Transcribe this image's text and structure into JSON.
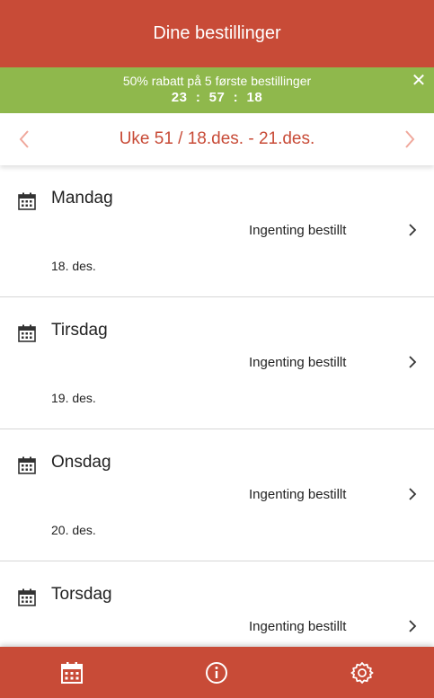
{
  "header": {
    "title": "Dine bestillinger"
  },
  "promo": {
    "text": "50% rabatt på 5 første bestillinger",
    "timer": "23  :  57  :  18",
    "close_icon": "close-icon"
  },
  "week_nav": {
    "label": "Uke 51 / 18.des. - 21.des.",
    "prev_icon": "chevron-left-icon",
    "next_icon": "chevron-right-icon"
  },
  "days": [
    {
      "name": "Mandag",
      "status": "Ingenting bestillt",
      "date": "18. des."
    },
    {
      "name": "Tirsdag",
      "status": "Ingenting bestillt",
      "date": "19. des."
    },
    {
      "name": "Onsdag",
      "status": "Ingenting bestillt",
      "date": "20. des."
    },
    {
      "name": "Torsdag",
      "status": "Ingenting bestillt",
      "date": ""
    }
  ],
  "bottom_nav": {
    "items": [
      {
        "icon": "calendar-icon"
      },
      {
        "icon": "info-icon"
      },
      {
        "icon": "settings-icon"
      }
    ]
  },
  "colors": {
    "brand": "#c84b37",
    "promo": "#8fb84c",
    "nav_arrow": "#f0a89c"
  }
}
